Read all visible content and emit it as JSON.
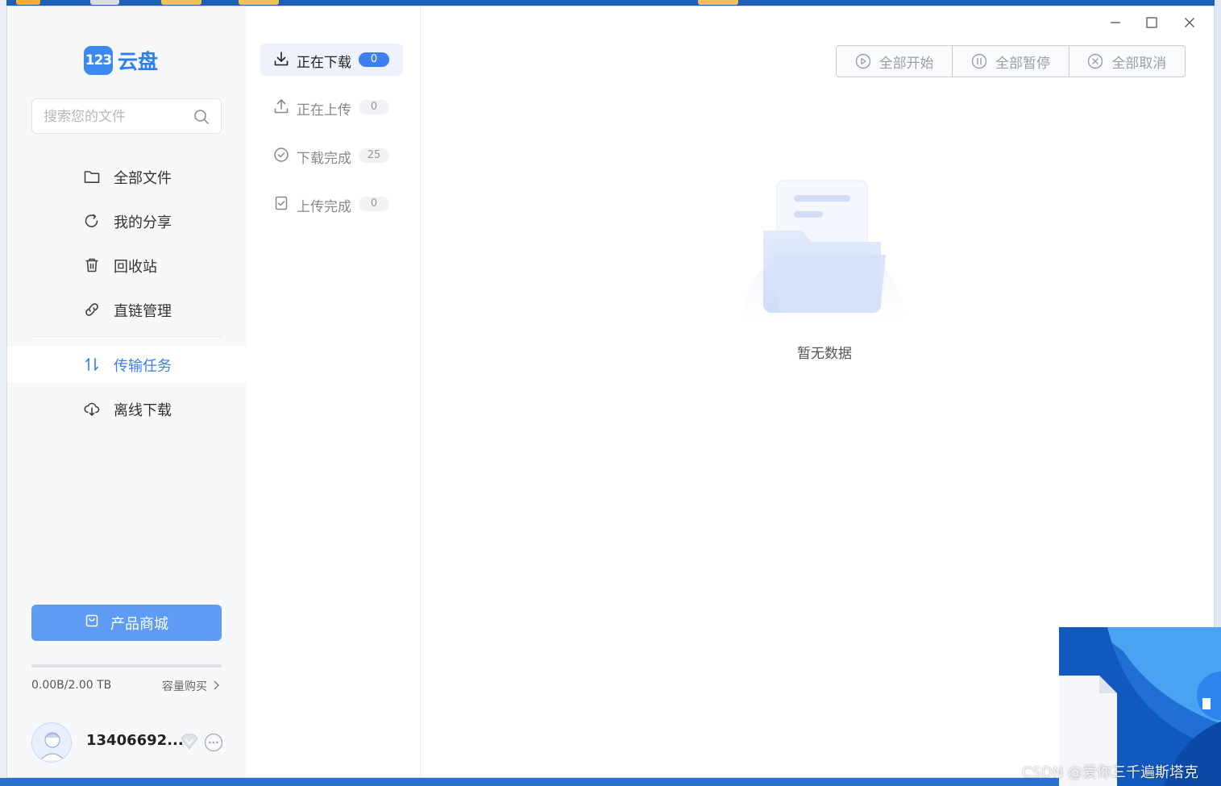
{
  "app": {
    "logo_mark": "123",
    "logo_text": "云盘"
  },
  "search": {
    "placeholder": "搜索您的文件"
  },
  "sidebar": {
    "items": [
      {
        "label": "全部文件",
        "icon": "folder-icon"
      },
      {
        "label": "我的分享",
        "icon": "share-icon"
      },
      {
        "label": "回收站",
        "icon": "trash-icon"
      },
      {
        "label": "直链管理",
        "icon": "link-icon"
      },
      {
        "label": "传输任务",
        "icon": "transfer-icon",
        "active": true
      },
      {
        "label": "离线下载",
        "icon": "cloud-download-icon"
      }
    ],
    "shop_label": "产品商城",
    "storage_used": "0.00B/2.00 TB",
    "storage_fraction": 0.0,
    "buy_label": "容量购买",
    "username": "13406692..."
  },
  "transfer_tabs": [
    {
      "label": "正在下载",
      "count": "0",
      "active": true,
      "icon": "download-icon"
    },
    {
      "label": "正在上传",
      "count": "0",
      "icon": "upload-icon"
    },
    {
      "label": "下载完成",
      "count": "25",
      "icon": "check-circle-icon"
    },
    {
      "label": "上传完成",
      "count": "0",
      "icon": "check-file-icon"
    }
  ],
  "toolbar": {
    "start_all": "全部开始",
    "pause_all": "全部暂停",
    "cancel_all": "全部取消"
  },
  "empty_state": {
    "text": "暂无数据"
  },
  "watermark": "CSDN @爱你三千遍斯塔克",
  "colors": {
    "accent": "#3b7ff0",
    "shop_button": "#5e9bf5",
    "sidebar_bg": "#f7f8fa"
  }
}
